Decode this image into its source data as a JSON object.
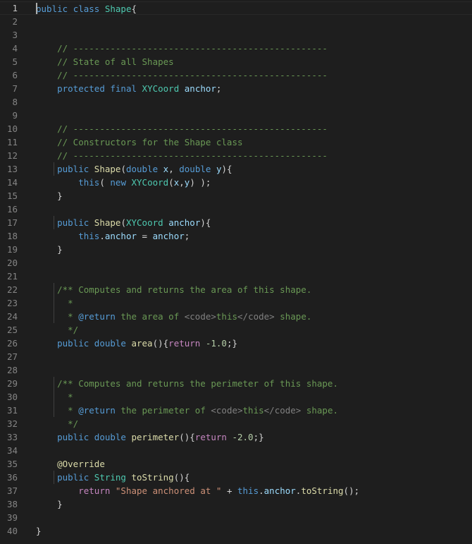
{
  "editor": {
    "language": "java",
    "active_line": 1,
    "line_count": 39,
    "colors": {
      "background": "#1e1e1e",
      "keyword": "#569cd6",
      "control": "#c586c0",
      "type": "#4ec9b0",
      "function": "#dcdcaa",
      "variable": "#9cdcfe",
      "string": "#ce9178",
      "number": "#b5cea8",
      "comment": "#6a9955"
    },
    "lines": [
      [
        [
          "kw",
          "public"
        ],
        [
          "plain",
          " "
        ],
        [
          "kw",
          "class"
        ],
        [
          "plain",
          " "
        ],
        [
          "cls",
          "Shape"
        ],
        [
          "plain",
          "{"
        ]
      ],
      [],
      [],
      [
        [
          "plain",
          "    "
        ],
        [
          "com",
          "// ------------------------------------------------"
        ]
      ],
      [
        [
          "plain",
          "    "
        ],
        [
          "com",
          "// State of all Shapes"
        ]
      ],
      [
        [
          "plain",
          "    "
        ],
        [
          "com",
          "// ------------------------------------------------"
        ]
      ],
      [
        [
          "plain",
          "    "
        ],
        [
          "kw",
          "protected"
        ],
        [
          "plain",
          " "
        ],
        [
          "kw",
          "final"
        ],
        [
          "plain",
          " "
        ],
        [
          "type",
          "XYCoord"
        ],
        [
          "plain",
          " "
        ],
        [
          "var",
          "anchor"
        ],
        [
          "plain",
          ";"
        ]
      ],
      [],
      [],
      [
        [
          "plain",
          "    "
        ],
        [
          "com",
          "// ------------------------------------------------"
        ]
      ],
      [
        [
          "plain",
          "    "
        ],
        [
          "com",
          "// Constructors for the Shape class"
        ]
      ],
      [
        [
          "plain",
          "    "
        ],
        [
          "com",
          "// ------------------------------------------------"
        ]
      ],
      [
        [
          "plain",
          "    "
        ],
        [
          "kw",
          "public"
        ],
        [
          "plain",
          " "
        ],
        [
          "fn",
          "Shape"
        ],
        [
          "plain",
          "("
        ],
        [
          "kw",
          "double"
        ],
        [
          "plain",
          " "
        ],
        [
          "var",
          "x"
        ],
        [
          "plain",
          ", "
        ],
        [
          "kw",
          "double"
        ],
        [
          "plain",
          " "
        ],
        [
          "var",
          "y"
        ],
        [
          "plain",
          "){"
        ]
      ],
      [
        [
          "plain",
          "        "
        ],
        [
          "kw",
          "this"
        ],
        [
          "plain",
          "( "
        ],
        [
          "kw",
          "new"
        ],
        [
          "plain",
          " "
        ],
        [
          "type",
          "XYCoord"
        ],
        [
          "plain",
          "("
        ],
        [
          "var",
          "x"
        ],
        [
          "plain",
          ","
        ],
        [
          "var",
          "y"
        ],
        [
          "plain",
          ") );"
        ]
      ],
      [
        [
          "plain",
          "    }"
        ]
      ],
      [],
      [
        [
          "plain",
          "    "
        ],
        [
          "kw",
          "public"
        ],
        [
          "plain",
          " "
        ],
        [
          "fn",
          "Shape"
        ],
        [
          "plain",
          "("
        ],
        [
          "type",
          "XYCoord"
        ],
        [
          "plain",
          " "
        ],
        [
          "var",
          "anchor"
        ],
        [
          "plain",
          "){"
        ]
      ],
      [
        [
          "plain",
          "        "
        ],
        [
          "kw",
          "this"
        ],
        [
          "plain",
          "."
        ],
        [
          "var",
          "anchor"
        ],
        [
          "plain",
          " = "
        ],
        [
          "var",
          "anchor"
        ],
        [
          "plain",
          ";"
        ]
      ],
      [
        [
          "plain",
          "    }"
        ]
      ],
      [],
      [],
      [
        [
          "plain",
          "    "
        ],
        [
          "com",
          "/** Computes and returns the area of this shape."
        ]
      ],
      [
        [
          "plain",
          "    "
        ],
        [
          "com",
          "  *"
        ]
      ],
      [
        [
          "plain",
          "    "
        ],
        [
          "com",
          "  * "
        ],
        [
          "ann",
          "@return"
        ],
        [
          "com",
          " the area of "
        ],
        [
          "tag",
          "<code>"
        ],
        [
          "com",
          "this"
        ],
        [
          "tag",
          "</code>"
        ],
        [
          "com",
          " shape."
        ]
      ],
      [
        [
          "plain",
          "    "
        ],
        [
          "com",
          "  */"
        ]
      ],
      [
        [
          "plain",
          "    "
        ],
        [
          "kw",
          "public"
        ],
        [
          "plain",
          " "
        ],
        [
          "kw",
          "double"
        ],
        [
          "plain",
          " "
        ],
        [
          "fn",
          "area"
        ],
        [
          "plain",
          "(){"
        ],
        [
          "kw2",
          "return"
        ],
        [
          "plain",
          " "
        ],
        [
          "num",
          "-1.0"
        ],
        [
          "plain",
          ";}"
        ]
      ],
      [],
      [],
      [
        [
          "plain",
          "    "
        ],
        [
          "com",
          "/** Computes and returns the perimeter of this shape."
        ]
      ],
      [
        [
          "plain",
          "    "
        ],
        [
          "com",
          "  *"
        ]
      ],
      [
        [
          "plain",
          "    "
        ],
        [
          "com",
          "  * "
        ],
        [
          "ann",
          "@return"
        ],
        [
          "com",
          " the perimeter of "
        ],
        [
          "tag",
          "<code>"
        ],
        [
          "com",
          "this"
        ],
        [
          "tag",
          "</code>"
        ],
        [
          "com",
          " shape."
        ]
      ],
      [
        [
          "plain",
          "    "
        ],
        [
          "com",
          "  */"
        ]
      ],
      [
        [
          "plain",
          "    "
        ],
        [
          "kw",
          "public"
        ],
        [
          "plain",
          " "
        ],
        [
          "kw",
          "double"
        ],
        [
          "plain",
          " "
        ],
        [
          "fn",
          "perimeter"
        ],
        [
          "plain",
          "(){"
        ],
        [
          "kw2",
          "return"
        ],
        [
          "plain",
          " "
        ],
        [
          "num",
          "-2.0"
        ],
        [
          "plain",
          ";}"
        ]
      ],
      [],
      [
        [
          "plain",
          "    "
        ],
        [
          "fn",
          "@Override"
        ]
      ],
      [
        [
          "plain",
          "    "
        ],
        [
          "kw",
          "public"
        ],
        [
          "plain",
          " "
        ],
        [
          "type",
          "String"
        ],
        [
          "plain",
          " "
        ],
        [
          "fn",
          "toString"
        ],
        [
          "plain",
          "(){"
        ]
      ],
      [
        [
          "plain",
          "        "
        ],
        [
          "kw2",
          "return"
        ],
        [
          "plain",
          " "
        ],
        [
          "str",
          "\"Shape anchored at \""
        ],
        [
          "plain",
          " + "
        ],
        [
          "kw",
          "this"
        ],
        [
          "plain",
          "."
        ],
        [
          "var",
          "anchor"
        ],
        [
          "plain",
          "."
        ],
        [
          "fn",
          "toString"
        ],
        [
          "plain",
          "();"
        ]
      ],
      [
        [
          "plain",
          "    }"
        ]
      ],
      [],
      [
        [
          "plain",
          "}"
        ]
      ]
    ]
  }
}
